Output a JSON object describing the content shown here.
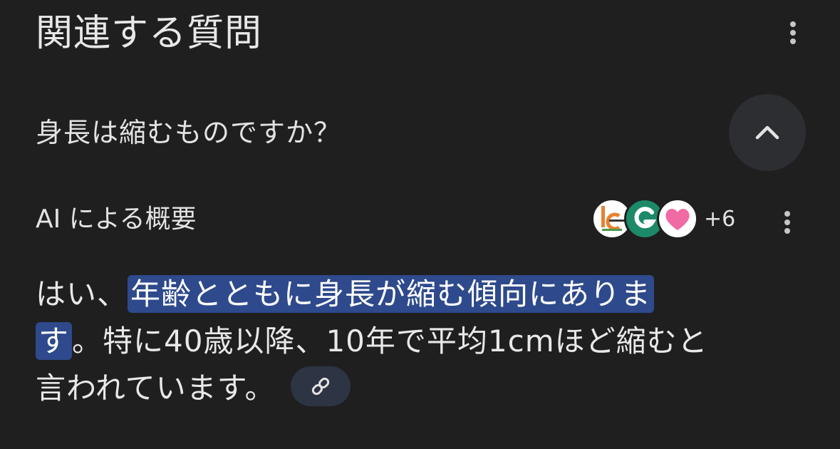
{
  "section": {
    "title": "関連する質問"
  },
  "question": {
    "text": "身長は縮むものですか？"
  },
  "overview": {
    "label": "AI による概要",
    "more_sources": "+6",
    "answer": {
      "prefix": "はい、",
      "highlight_line1": "年齢とともに身長が縮む傾向にありま",
      "highlight_line2": "す",
      "rest_line2": "。特に40歳以降、10年で平均1cmほど縮むと",
      "line3": "言われています。"
    }
  },
  "colors": {
    "background": "#1f1f1f",
    "highlight": "#2e4a8c",
    "button_bg": "#2d2e31",
    "link_chip_bg": "#2d3443"
  },
  "icons": {
    "header_menu": "more-vert-icon",
    "collapse": "chevron-up-icon",
    "overview_menu": "more-vert-icon",
    "link": "link-icon"
  }
}
